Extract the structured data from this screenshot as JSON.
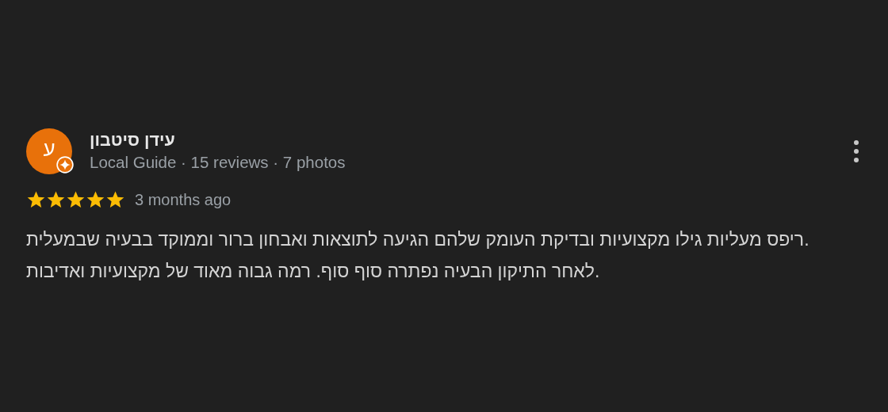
{
  "review": {
    "avatar_letter": "ע",
    "author": "עידן סיטבון",
    "author_meta": "Local Guide · 15 reviews · 7 photos",
    "stars": 5,
    "time": "3 months ago",
    "text": "ריפס מעליות גילו מקצועיות ובדיקת העומק שלהם הגיעה לתוצאות ואבחון ברור וממוקד בבעיה שבמעלית.\nלאחר התיקון הבעיה נפתרה סוף סוף. רמה גבוה מאוד של מקצועיות ואדיבות."
  }
}
